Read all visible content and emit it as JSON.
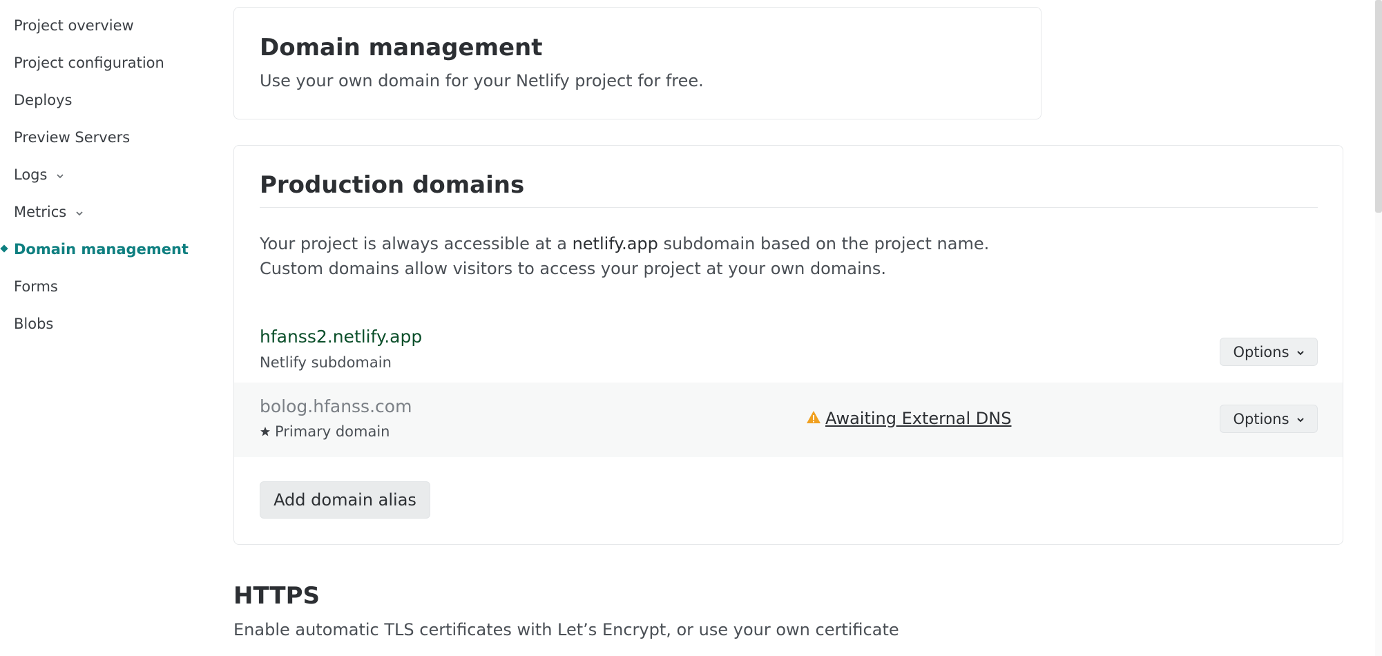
{
  "sidebar": {
    "items": [
      {
        "label": "Project overview"
      },
      {
        "label": "Project configuration"
      },
      {
        "label": "Deploys"
      },
      {
        "label": "Preview Servers"
      },
      {
        "label": "Logs"
      },
      {
        "label": "Metrics"
      },
      {
        "label": "Domain management"
      },
      {
        "label": "Forms"
      },
      {
        "label": "Blobs"
      }
    ],
    "active_item": "Domain management"
  },
  "header_card": {
    "title": "Domain management",
    "subtitle": "Use your own domain for your Netlify project for free."
  },
  "production_domains": {
    "title": "Production domains",
    "intro_line1_before": "Your project is always accessible at a ",
    "intro_line1_highlight": "netlify.app",
    "intro_line1_after": " subdomain based on the project name.",
    "intro_line2": "Custom domains allow visitors to access your project at your own domains.",
    "domains": [
      {
        "name": "hfanss2.netlify.app",
        "note": "Netlify subdomain",
        "options_label": "Options"
      },
      {
        "name": "bolog.hfanss.com",
        "note": "Primary domain",
        "status": "Awaiting External DNS",
        "options_label": "Options"
      }
    ],
    "add_alias_label": "Add domain alias"
  },
  "https": {
    "title": "HTTPS",
    "subtitle": "Enable automatic TLS certificates with Let’s Encrypt, or use your own certificate"
  },
  "colors": {
    "accent": "#0e7f80",
    "warning": "#f0a020",
    "domain_green": "#0b4f2a"
  },
  "icons": [
    "chevron-down-icon",
    "star-icon",
    "warning-icon"
  ]
}
